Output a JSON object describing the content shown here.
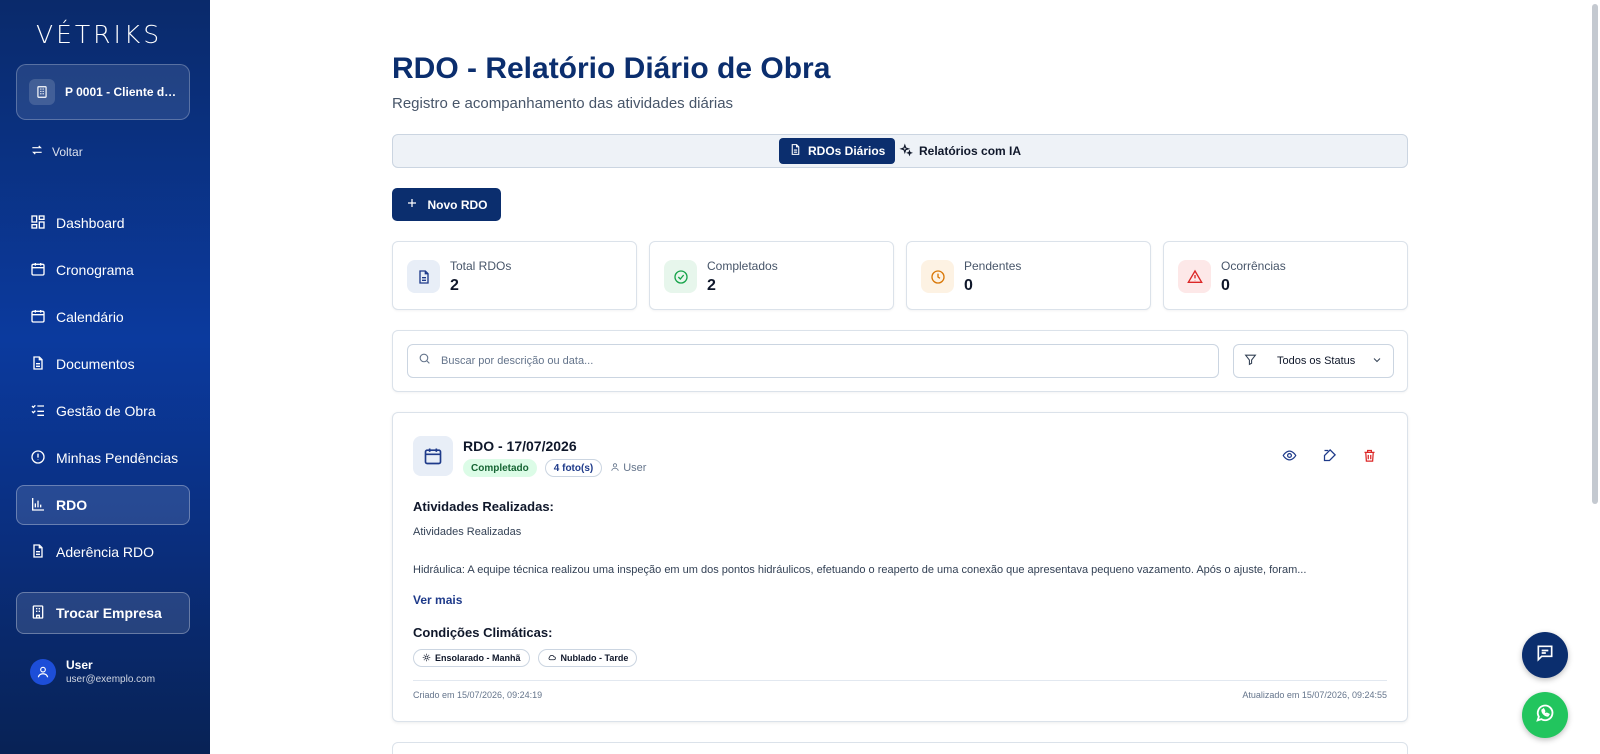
{
  "sidebar": {
    "logo": "VÉTRIKS",
    "project": "P 0001 - Cliente de...",
    "back_label": "Voltar",
    "items": [
      {
        "label": "Dashboard",
        "icon": "dashboard-icon"
      },
      {
        "label": "Cronograma",
        "icon": "calendar-icon"
      },
      {
        "label": "Calendário",
        "icon": "calendar-grid-icon"
      },
      {
        "label": "Documentos",
        "icon": "document-icon"
      },
      {
        "label": "Gestão de Obra",
        "icon": "checklist-icon"
      },
      {
        "label": "Minhas Pendências",
        "icon": "alert-circle-icon"
      },
      {
        "label": "RDO",
        "icon": "bar-chart-icon",
        "active": true
      },
      {
        "label": "Aderência RDO",
        "icon": "document-icon"
      }
    ],
    "switch_label": "Trocar Empresa",
    "user": {
      "name": "User",
      "email": "user@exemplo.com"
    }
  },
  "header": {
    "title": "RDO - Relatório Diário de Obra",
    "subtitle": "Registro e acompanhamento das atividades diárias"
  },
  "tabs": [
    {
      "label": "RDOs Diários",
      "active": true
    },
    {
      "label": "Relatórios com IA",
      "active": false
    }
  ],
  "new_button": "Novo RDO",
  "stats": [
    {
      "label": "Total RDOs",
      "value": "2",
      "color": "#1e3a8a",
      "bg": "#e8eef7"
    },
    {
      "label": "Completados",
      "value": "2",
      "color": "#16a34a",
      "bg": "#e7f6ec"
    },
    {
      "label": "Pendentes",
      "value": "0",
      "color": "#d97706",
      "bg": "#fdf2e3"
    },
    {
      "label": "Ocorrências",
      "value": "0",
      "color": "#dc2626",
      "bg": "#fde8e8"
    }
  ],
  "search": {
    "placeholder": "Buscar por descrição ou data...",
    "value": ""
  },
  "status_filter": {
    "selected": "Todos os Status"
  },
  "rdo": {
    "title": "RDO - 17/07/2026",
    "status": "Completado",
    "photos": "4 foto(s)",
    "user": "User",
    "activities_heading": "Atividades Realizadas:",
    "activities_line1": "Atividades Realizadas",
    "activities_line2": "Hidráulica: A equipe técnica realizou uma inspeção em um dos pontos hidráulicos, efetuando o reaperto de uma conexão que apresentava pequeno vazamento. Após o ajuste, foram...",
    "more_label": "Ver mais",
    "weather_heading": "Condições Climáticas:",
    "weather": [
      "Ensolarado - Manhã",
      "Nublado - Tarde"
    ],
    "created": "Criado em 15/07/2026, 09:24:19",
    "updated": "Atualizado em 15/07/2026, 09:24:55"
  },
  "colors": {
    "primary": "#0b2e6e",
    "whatsapp": "#22c55e",
    "delete": "#dc2626"
  }
}
